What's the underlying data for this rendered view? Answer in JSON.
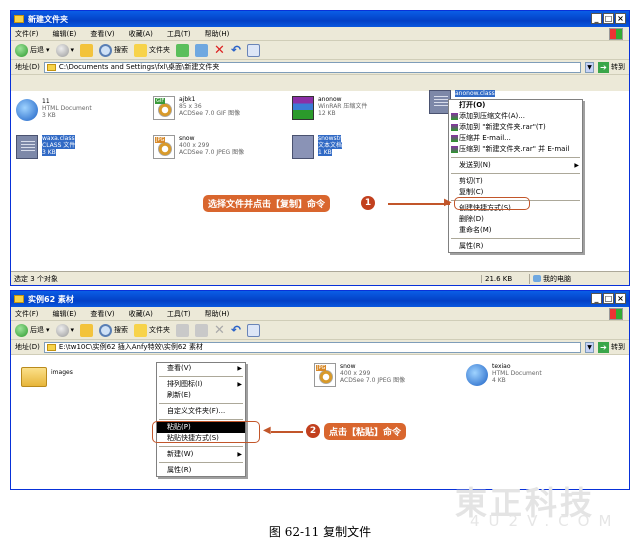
{
  "window1": {
    "title": "新建文件夹",
    "menu": [
      "文件(F)",
      "编辑(E)",
      "查看(V)",
      "收藏(A)",
      "工具(T)",
      "帮助(H)"
    ],
    "toolbar": {
      "back": "后退",
      "search": "搜索",
      "folders": "文件夹"
    },
    "address_label": "地址(D)",
    "address_value": "C:\\Documents and Settings\\fxl\\桌面\\新建文件夹",
    "go_label": "转到",
    "files": [
      {
        "name": "11",
        "line2": "HTML Document",
        "line3": "3 KB"
      },
      {
        "name": "ajbk1",
        "line2": "85 x 36",
        "line3": "ACDSee 7.0 GIF 图像",
        "badge": "GIF"
      },
      {
        "name": "anonow",
        "line2": "WinRAR 压缩文件",
        "line3": "12 KB"
      },
      {
        "name": "anonow.class"
      },
      {
        "name": "waxa.class",
        "line2": "CLASS 文件",
        "line3": "3 KB"
      },
      {
        "name": "snow",
        "line2": "400 x 299",
        "line3": "ACDSee 7.0 JPEG 图像",
        "badge": "JPG"
      },
      {
        "name": "snowstr",
        "line2": "文本文档",
        "line3": "1 KB"
      }
    ],
    "context_menu": [
      "打开(O)",
      "添加到压缩文件(A)...",
      "添加到 \"新建文件夹.rar\"(T)",
      "压缩并 E-mail...",
      "压缩到 \"新建文件夹.rar\" 并 E-mail",
      "发送到(N)",
      "剪切(T)",
      "复制(C)",
      "创建快捷方式(S)",
      "删除(D)",
      "重命名(M)",
      "属性(R)"
    ],
    "callout": "选择文件并点击【复制】命令",
    "callout_num": "1",
    "status_left": "选定 3 个对象",
    "status_size": "21.6 KB",
    "status_location": "我的电脑"
  },
  "window2": {
    "title": "实例62 素材",
    "menu": [
      "文件(F)",
      "编辑(E)",
      "查看(V)",
      "收藏(A)",
      "工具(T)",
      "帮助(H)"
    ],
    "toolbar": {
      "back": "后退",
      "search": "搜索",
      "folders": "文件夹"
    },
    "address_label": "地址(D)",
    "address_value": "E:\\tw10C\\实例62  插入Anfy特效\\实例62 素材",
    "go_label": "转到",
    "files": [
      {
        "name": "images"
      },
      {
        "name": "snow",
        "line2": "400 x 299",
        "line3": "ACDSee 7.0 JPEG 图像",
        "badge": "JPG"
      },
      {
        "name": "texiao",
        "line2": "HTML Document",
        "line3": "4 KB"
      }
    ],
    "context_menu": [
      "查看(V)",
      "排列图标(I)",
      "刷新(E)",
      "自定义文件夹(F)...",
      "粘贴(P)",
      "粘贴快捷方式(S)",
      "新建(W)",
      "属性(R)"
    ],
    "callout": "点击【粘贴】命令",
    "callout_num": "2"
  },
  "caption": "图 62-11    复制文件",
  "watermark": {
    "line1": "東正科技",
    "line2": "4U2V.COM"
  }
}
